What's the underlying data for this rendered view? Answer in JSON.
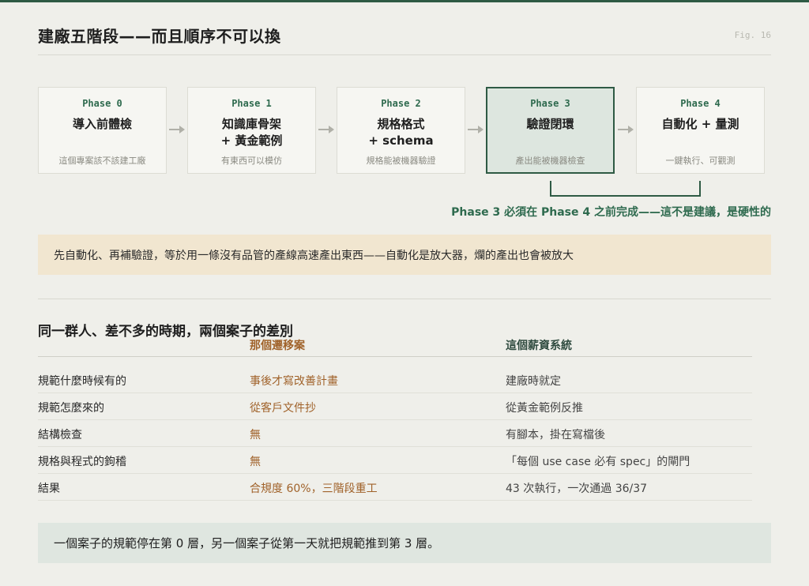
{
  "title": "建廠五階段——而且順序不可以換",
  "fig_label": "Fig. 16",
  "phases": [
    {
      "label": "Phase 0",
      "name_line1": "導入前體檢",
      "name_line2": "",
      "sub": "這個專案該不該建工廠"
    },
    {
      "label": "Phase 1",
      "name_line1": "知識庫骨架",
      "name_line2": "+ 黃金範例",
      "sub": "有東西可以模仿"
    },
    {
      "label": "Phase 2",
      "name_line1": "規格格式",
      "name_line2": "+ schema",
      "sub": "規格能被機器驗證"
    },
    {
      "label": "Phase 3",
      "name_line1": "驗證閉環",
      "name_line2": "",
      "sub": "產出能被機器檢查"
    },
    {
      "label": "Phase 4",
      "name_line1": "自動化 + 量測",
      "name_line2": "",
      "sub": "一鍵執行、可觀測"
    }
  ],
  "highlight_note": "Phase 3 必須在 Phase 4 之前完成——這不是建議，是硬性的",
  "callout_top": "先自動化、再補驗證，等於用一條沒有品管的產線高速產出東西——自動化是放大器，爛的產出也會被放大",
  "comparison": {
    "title": "同一群人、差不多的時期，兩個案子的差別",
    "col_a": "那個遷移案",
    "col_b": "這個薪資系統",
    "rows": [
      {
        "label": "規範什麼時候有的",
        "a": "事後才寫改善計畫",
        "b": "建廠時就定"
      },
      {
        "label": "規範怎麼來的",
        "a": "從客戶文件抄",
        "b": "從黃金範例反推"
      },
      {
        "label": "結構檢查",
        "a": "無",
        "b": "有腳本，掛在寫檔後"
      },
      {
        "label": "規格與程式的鉤稽",
        "a": "無",
        "b": "「每個 use case 必有 spec」的閘門"
      },
      {
        "label": "結果",
        "a": "合規度 60%，三階段重工",
        "b": "43 次執行，一次通過 36/37"
      }
    ]
  },
  "callout_bottom": "一個案子的規範停在第 0 層，另一個案子從第一天就把規範推到第 3 層。",
  "colors": {
    "accent_green": "#2e5a44",
    "accent_orange": "#a0622a",
    "callout_top_bg": "#f1e6d0",
    "callout_bottom_bg": "#dfe6e0"
  }
}
